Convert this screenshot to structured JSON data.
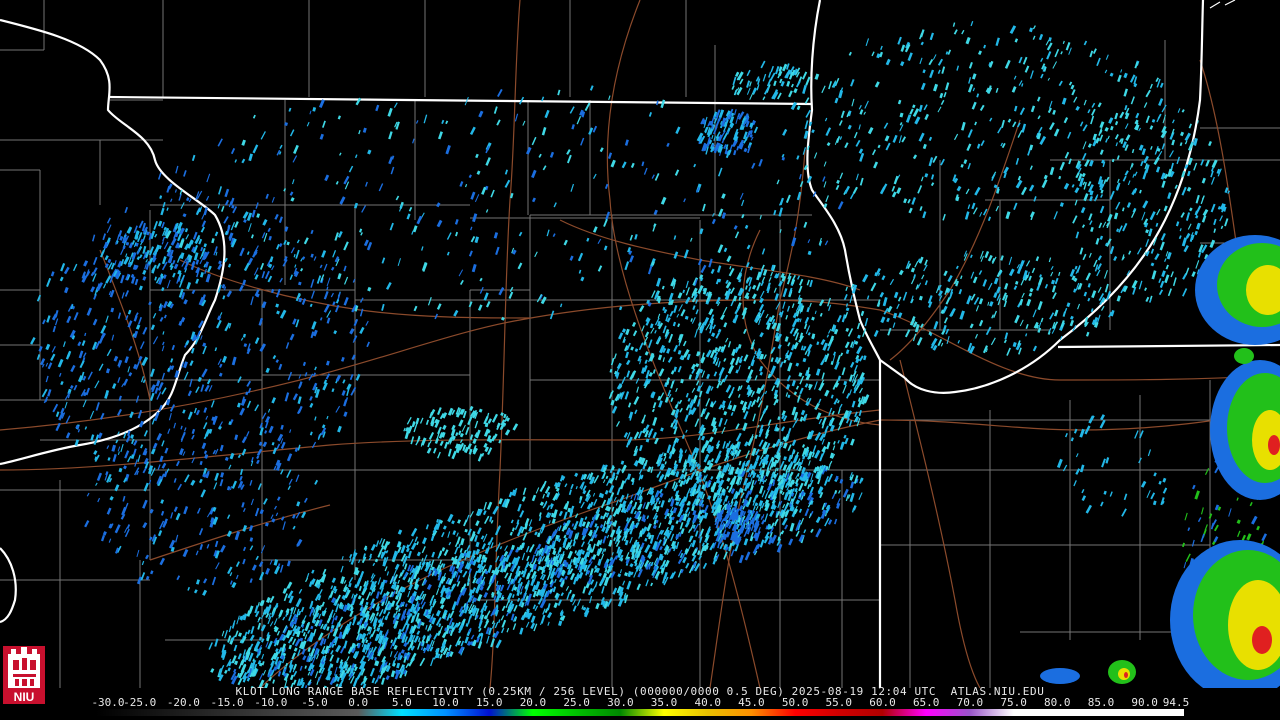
{
  "radar": {
    "caption": "KLOT LONG RANGE BASE REFLECTIVITY (0.25KM / 256 LEVEL) (000000/0000 0.5 DEG) 2025-08-19 12:04 UTC  ATLAS.NIU.EDU",
    "logo_text": "NIU",
    "colorbar": {
      "labels": [
        "-30.0",
        "-25.0",
        "-20.0",
        "-15.0",
        "-10.0",
        "-5.0",
        "0.0",
        "5.0",
        "10.0",
        "15.0",
        "20.0",
        "25.0",
        "30.0",
        "35.0",
        "40.0",
        "45.0",
        "50.0",
        "55.0",
        "60.0",
        "65.0",
        "70.0",
        "75.0",
        "80.0",
        "85.0",
        "90.0",
        "94.5"
      ],
      "stops": [
        {
          "dbz": -30,
          "color": "#000000"
        },
        {
          "dbz": 0,
          "color": "#5a5a5a"
        },
        {
          "dbz": 5,
          "color": "#00e0ff"
        },
        {
          "dbz": 10,
          "color": "#0090ff"
        },
        {
          "dbz": 15,
          "color": "#0010d0"
        },
        {
          "dbz": 20,
          "color": "#00ff00"
        },
        {
          "dbz": 25,
          "color": "#00c000"
        },
        {
          "dbz": 30,
          "color": "#008800"
        },
        {
          "dbz": 35,
          "color": "#ffff00"
        },
        {
          "dbz": 40,
          "color": "#e8c000"
        },
        {
          "dbz": 45,
          "color": "#ff9000"
        },
        {
          "dbz": 50,
          "color": "#ff0000"
        },
        {
          "dbz": 55,
          "color": "#d00000"
        },
        {
          "dbz": 60,
          "color": "#b00000"
        },
        {
          "dbz": 65,
          "color": "#ff00ff"
        },
        {
          "dbz": 70,
          "color": "#9955c9"
        },
        {
          "dbz": 75,
          "color": "#ffffff"
        },
        {
          "dbz": 94.5,
          "color": "#ffffff"
        }
      ]
    },
    "colors": {
      "background": "#000000",
      "state_lines": "#ffffff",
      "county_lines": "#8a8a8a",
      "highways": "#8b4a2b",
      "echo_light_cyan": "#3fd9e6",
      "echo_cyan": "#22b8e8",
      "echo_blue": "#1b6ee0",
      "echo_green": "#22c01a",
      "echo_yellow": "#e8e000",
      "echo_red": "#e02020"
    }
  }
}
